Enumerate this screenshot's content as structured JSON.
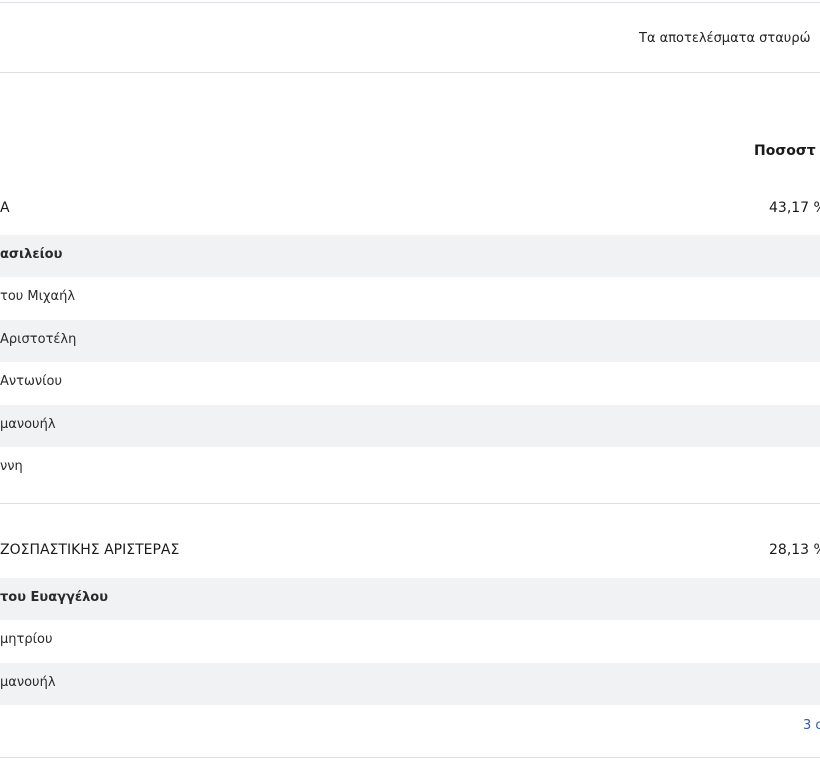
{
  "note": {
    "text": "Τα αποτελέσματα σταυρώ"
  },
  "table": {
    "column_header": "Ποσοστ"
  },
  "parties": [
    {
      "name": "Α",
      "percent": "43,17 %",
      "candidates": [
        {
          "name": "ασιλείου"
        },
        {
          "name": "του Μιχαήλ"
        },
        {
          "name": "Αριστοτέλη"
        },
        {
          "name": "Αντωνίου"
        },
        {
          "name": "μανουήλ"
        },
        {
          "name": "ννη"
        }
      ]
    },
    {
      "name": "ΖΟΣΠΑΣΤΙΚΗΣ ΑΡΙΣΤΕΡΑΣ",
      "percent": "28,13 %",
      "candidates": [
        {
          "name": "του Ευαγγέλου"
        },
        {
          "name": "μητρίου"
        },
        {
          "name": "μανουήλ"
        }
      ]
    }
  ],
  "more_link": {
    "text": "3 ο"
  }
}
